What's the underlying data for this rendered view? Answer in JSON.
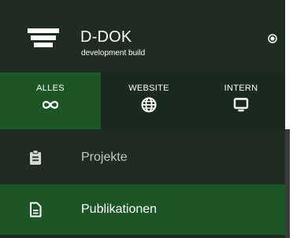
{
  "app": {
    "title": "D-DOK",
    "subtitle": "development build"
  },
  "filters": [
    {
      "label": "ALLES",
      "icon": "infinity-icon",
      "active": true
    },
    {
      "label": "WEBSITE",
      "icon": "globe-icon",
      "active": false
    },
    {
      "label": "INTERN",
      "icon": "monitor-icon",
      "active": false
    }
  ],
  "menu": [
    {
      "label": "Projekte",
      "icon": "clipboard-icon",
      "active": false
    },
    {
      "label": "Publikationen",
      "icon": "document-icon",
      "active": true
    }
  ],
  "colors": {
    "sidebar_bg": "#1f2c22",
    "filter_row_bg": "#1b2a1e",
    "accent_active": "#1c5626",
    "text_primary": "#ffffff",
    "text_muted": "#c3c8c3"
  }
}
